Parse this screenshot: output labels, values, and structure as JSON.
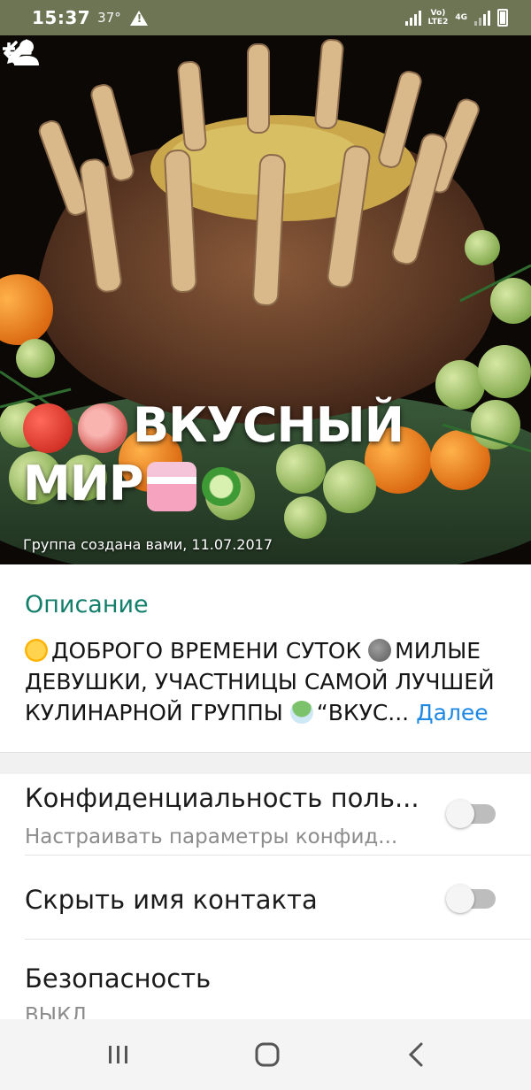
{
  "status_bar": {
    "time": "15:37",
    "temperature": "37°",
    "network_top": "Vo)",
    "network_bottom": "LTE2",
    "network_type": "4G"
  },
  "header": {
    "group_name_line1": "ВКУСНЫЙ",
    "group_name_line2": "МИР",
    "created_info": "Группа создана вами, 11.07.2017",
    "icons": [
      "back-arrow-icon",
      "add-person-icon",
      "pencil-icon"
    ]
  },
  "description": {
    "label": "Описание",
    "text_part1": "ДОБРОГО ВРЕМЕНИ СУТОК",
    "text_part2": "МИЛЫЕ ДЕВУШКИ, УЧАСТНИЦЫ САМОЙ ЛУЧШЕЙ КУЛИНАРНОЙ ГРУППЫ",
    "text_part3": "“ВКУС...",
    "more_link": "Далее"
  },
  "settings": [
    {
      "title": "Конфиденциальность поль...",
      "subtitle": "Настраивать параметры конфид...",
      "toggle_on": false
    },
    {
      "title": "Скрыть имя контакта",
      "toggle_on": false
    },
    {
      "title": "Безопасность",
      "subtitle": "ВЫКЛ."
    }
  ],
  "nav_bar": {
    "buttons": [
      "recent-apps-icon",
      "home-icon",
      "back-icon"
    ]
  },
  "colors": {
    "status_bar": "#6d7555",
    "accent_green": "#137f6b",
    "link_blue": "#1e88e5"
  }
}
